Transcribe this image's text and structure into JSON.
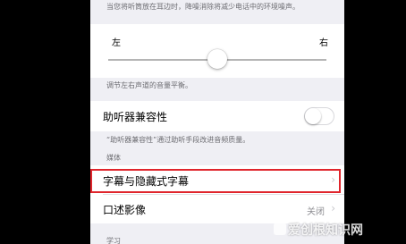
{
  "top_note": "当您将听筒放在耳边时，降噪消除将减少电话中的环境噪声。",
  "balance": {
    "left_label": "左",
    "right_label": "右",
    "value": 0.5,
    "note": "调节左右声道的音量平衡。"
  },
  "hearing_aid": {
    "label": "助听器兼容性",
    "enabled": false,
    "note": "“助听器兼容性”通过助听手段改进音频质量。"
  },
  "media_section": {
    "header": "媒体",
    "items": [
      {
        "label": "字幕与隐藏式字幕",
        "value": "",
        "chevron": "›"
      },
      {
        "label": "口述影像",
        "value": "关闭",
        "chevron": "›"
      }
    ]
  },
  "bottom_header": "学习",
  "highlight_color": "#e0252c",
  "watermark": "爱创根知识网"
}
